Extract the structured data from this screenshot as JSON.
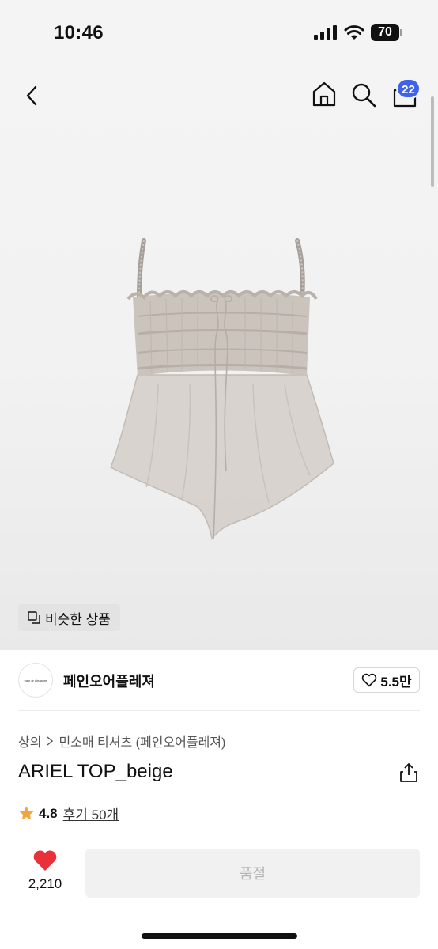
{
  "status_bar": {
    "time": "10:46",
    "battery": "70"
  },
  "nav": {
    "cart_count": "22"
  },
  "similar_products_label": "비슷한 상품",
  "brand": {
    "name": "페인오어플레져",
    "logo_text": "pain or pleasure",
    "likes": "5.5만"
  },
  "breadcrumb": {
    "category": "상의",
    "subcategory": "민소매 티셔츠 (페인오어플레져)"
  },
  "product": {
    "title": "ARIEL TOP_beige",
    "rating": "4.8",
    "reviews": "후기 50개"
  },
  "wishlist": {
    "count": "2,210"
  },
  "purchase": {
    "button_label": "품절"
  },
  "colors": {
    "accent": "#3f63e6",
    "heart": "#e8313a",
    "star": "#f1a53a"
  }
}
